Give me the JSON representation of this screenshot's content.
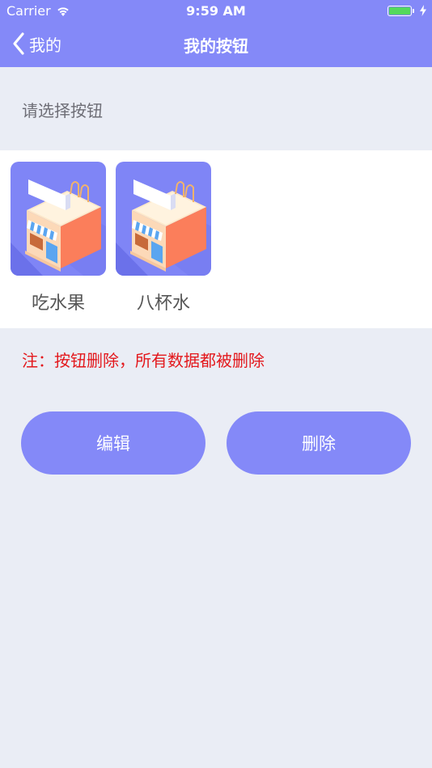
{
  "status_bar": {
    "carrier": "Carrier",
    "time": "9:59 AM",
    "battery_level": 1.0
  },
  "nav": {
    "back_label": "我的",
    "title": "我的按钮"
  },
  "prompt": "请选择按钮",
  "items": [
    {
      "label": "吃水果",
      "icon": "shop-icon"
    },
    {
      "label": "八杯水",
      "icon": "shop-icon"
    }
  ],
  "note": "注：按钮删除，所有数据都被删除",
  "actions": {
    "edit_label": "编辑",
    "delete_label": "删除"
  },
  "colors": {
    "accent": "#8489f8",
    "background": "#eaedf5",
    "warning": "#e3181c",
    "battery": "#54d85d"
  }
}
